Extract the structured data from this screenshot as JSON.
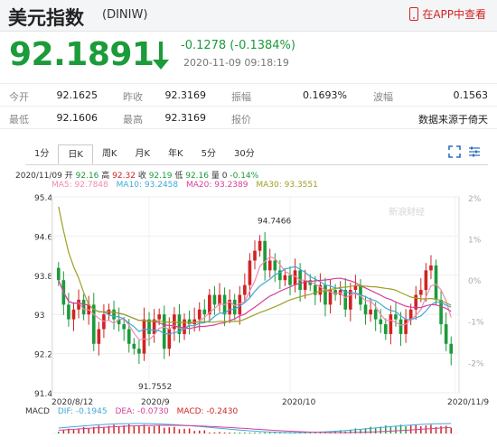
{
  "header": {
    "title": "美元指数",
    "code": "(DINIW)",
    "app_link": "在APP中查看"
  },
  "quote": {
    "price": "92.1891",
    "change": "-0.1278 (-0.1384%)",
    "time": "2020-11-09 09:18:19"
  },
  "stats": {
    "row1": [
      {
        "label": "今开",
        "value": "92.1625"
      },
      {
        "label": "昨收",
        "value": "92.3169"
      },
      {
        "label": "振幅",
        "value": "0.1693%"
      },
      {
        "label": "波幅",
        "value": "0.1563"
      }
    ],
    "row2": [
      {
        "label": "最低",
        "value": "92.1606"
      },
      {
        "label": "最高",
        "value": "92.3169"
      },
      {
        "label": "报价",
        "value": ""
      },
      {
        "label": "",
        "value": "数据来源于倚天"
      }
    ]
  },
  "tabs": [
    "1分",
    "日K",
    "周K",
    "月K",
    "年K",
    "5分",
    "30分"
  ],
  "active_tab": "日K",
  "ohlc_line": {
    "date": "2020/11/09",
    "open_label": "开",
    "open": "92.16",
    "high_label": "高",
    "high": "92.32",
    "close_label": "收",
    "close": "92.19",
    "low_label": "低",
    "low": "92.16",
    "vol_label": "量",
    "vol": "0",
    "pct": "-0.14%"
  },
  "ma_labels": [
    {
      "text": "MA5: 92.7848",
      "color": "#f08ab0"
    },
    {
      "text": "MA10: 93.2458",
      "color": "#3fa9d9"
    },
    {
      "text": "MA20: 93.2389",
      "color": "#d6409a"
    },
    {
      "text": "MA30: 93.3551",
      "color": "#9ca022"
    }
  ],
  "macd_labels": [
    {
      "text": "MACD",
      "color": "#333333"
    },
    {
      "text": "DIF: -0.1945",
      "color": "#3fa9d9"
    },
    {
      "text": "DEA: -0.0730",
      "color": "#d6409a"
    },
    {
      "text": "MACD: -0.2430",
      "color": "#d12323"
    }
  ],
  "watermark": "新浪财经",
  "colors": {
    "up": "#d12323",
    "down": "#1b9b39"
  },
  "chart_data": {
    "type": "candlestick",
    "y_ticks": [
      "95.4",
      "94.6",
      "93.8",
      "93",
      "92.2",
      "91.4"
    ],
    "pct_ticks": [
      "2%",
      "1%",
      "0%",
      "-1%",
      "-2%"
    ],
    "x_ticks": [
      "2020/8/12",
      "2020/9",
      "2020/10",
      "2020/11/9"
    ],
    "ylim": [
      91.4,
      95.4
    ],
    "annotations": [
      {
        "text": "94.7466"
      },
      {
        "text": "91.7552"
      }
    ],
    "closes": [
      93.7,
      93.2,
      92.9,
      93.1,
      93.3,
      93.0,
      93.2,
      92.4,
      92.7,
      93.0,
      93.1,
      92.9,
      92.8,
      92.7,
      92.4,
      92.3,
      92.2,
      92.9,
      92.6,
      92.9,
      93.0,
      92.3,
      92.7,
      93.0,
      92.6,
      92.9,
      92.8,
      92.9,
      93.1,
      93.0,
      93.4,
      93.2,
      93.4,
      93.0,
      93.3,
      93.0,
      93.4,
      93.6,
      94.1,
      94.3,
      94.5,
      93.9,
      94.1,
      93.9,
      93.7,
      93.8,
      93.6,
      93.9,
      93.5,
      93.7,
      93.6,
      93.4,
      93.6,
      93.2,
      93.5,
      93.4,
      93.5,
      93.1,
      93.5,
      93.6,
      93.2,
      93.0,
      93.1,
      92.9,
      92.8,
      92.6,
      93.0,
      92.9,
      92.6,
      92.9,
      93.1,
      93.4,
      93.5,
      93.9,
      94.0,
      93.3,
      92.8,
      92.4,
      92.2
    ]
  }
}
